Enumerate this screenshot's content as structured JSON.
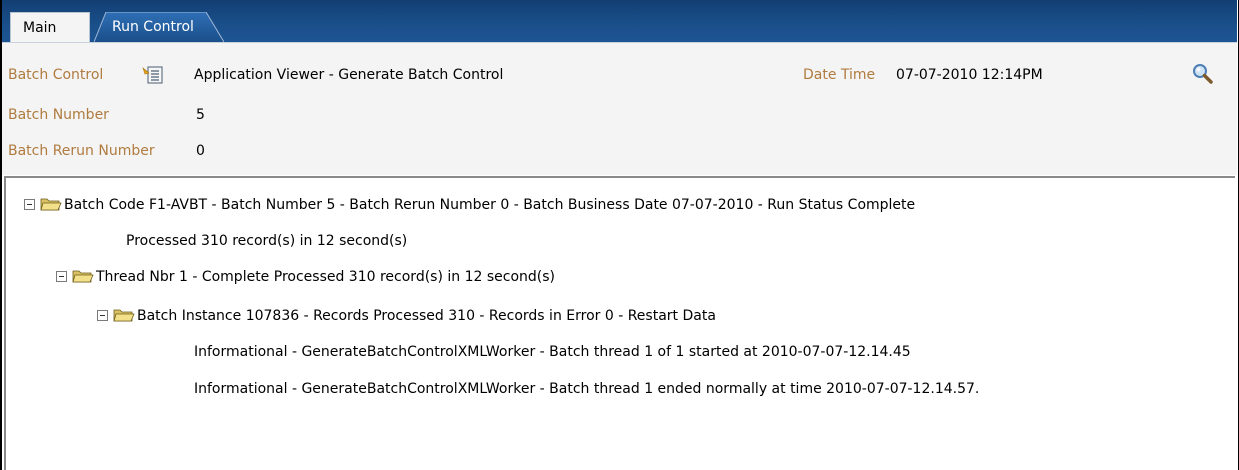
{
  "tabs": [
    {
      "label": "Main"
    },
    {
      "label": "Run Control"
    }
  ],
  "header": {
    "batch_control_label": "Batch Control",
    "batch_control_value": "Application Viewer - Generate Batch Control",
    "date_time_label": "Date Time",
    "date_time_value": "07-07-2010 12:14PM",
    "batch_number_label": "Batch Number",
    "batch_number_value": "5",
    "batch_rerun_label": "Batch Rerun Number",
    "batch_rerun_value": "0"
  },
  "tree": {
    "root": "Batch Code F1-AVBT - Batch Number 5 - Batch Rerun Number 0 - Batch Business Date 07-07-2010 - Run Status Complete",
    "root_summary": "Processed 310 record(s) in 12 second(s)",
    "thread": "Thread Nbr 1 - Complete Processed 310 record(s) in 12 second(s)",
    "instance": "Batch Instance 107836 - Records Processed 310 - Records in Error 0 - Restart Data",
    "messages": [
      "Informational - GenerateBatchControlXMLWorker - Batch thread 1 of 1 started at 2010-07-07-12.14.45",
      "Informational - GenerateBatchControlXMLWorker - Batch thread 1 ended normally at time 2010-07-07-12.14.57."
    ]
  },
  "colors": {
    "tab_bar": "#1a4f8a",
    "label": "#b07b3f",
    "panel_bg": "#f4f4f4"
  },
  "icons": {
    "batch_control": "list-document-icon",
    "search": "magnifier-icon",
    "folder": "open-folder-icon",
    "toggle": "collapse-minus-icon"
  }
}
